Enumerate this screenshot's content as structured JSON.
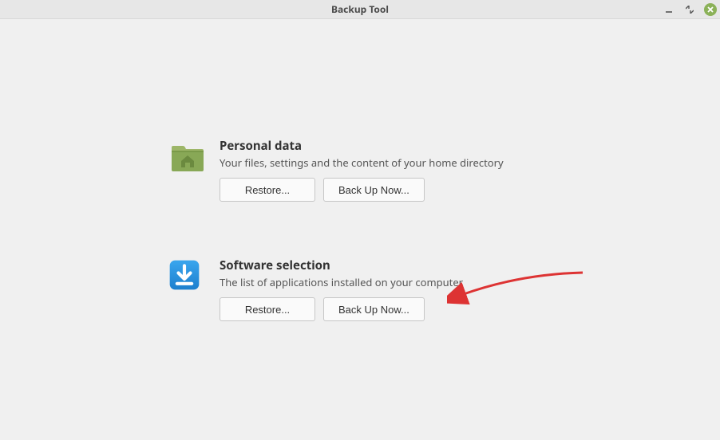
{
  "window": {
    "title": "Backup Tool"
  },
  "sections": {
    "personal": {
      "title": "Personal data",
      "desc": "Your files, settings and the content of your home directory",
      "restore": "Restore...",
      "backup": "Back Up Now..."
    },
    "software": {
      "title": "Software selection",
      "desc": "The list of applications installed on your computer",
      "restore": "Restore...",
      "backup": "Back Up Now..."
    }
  }
}
